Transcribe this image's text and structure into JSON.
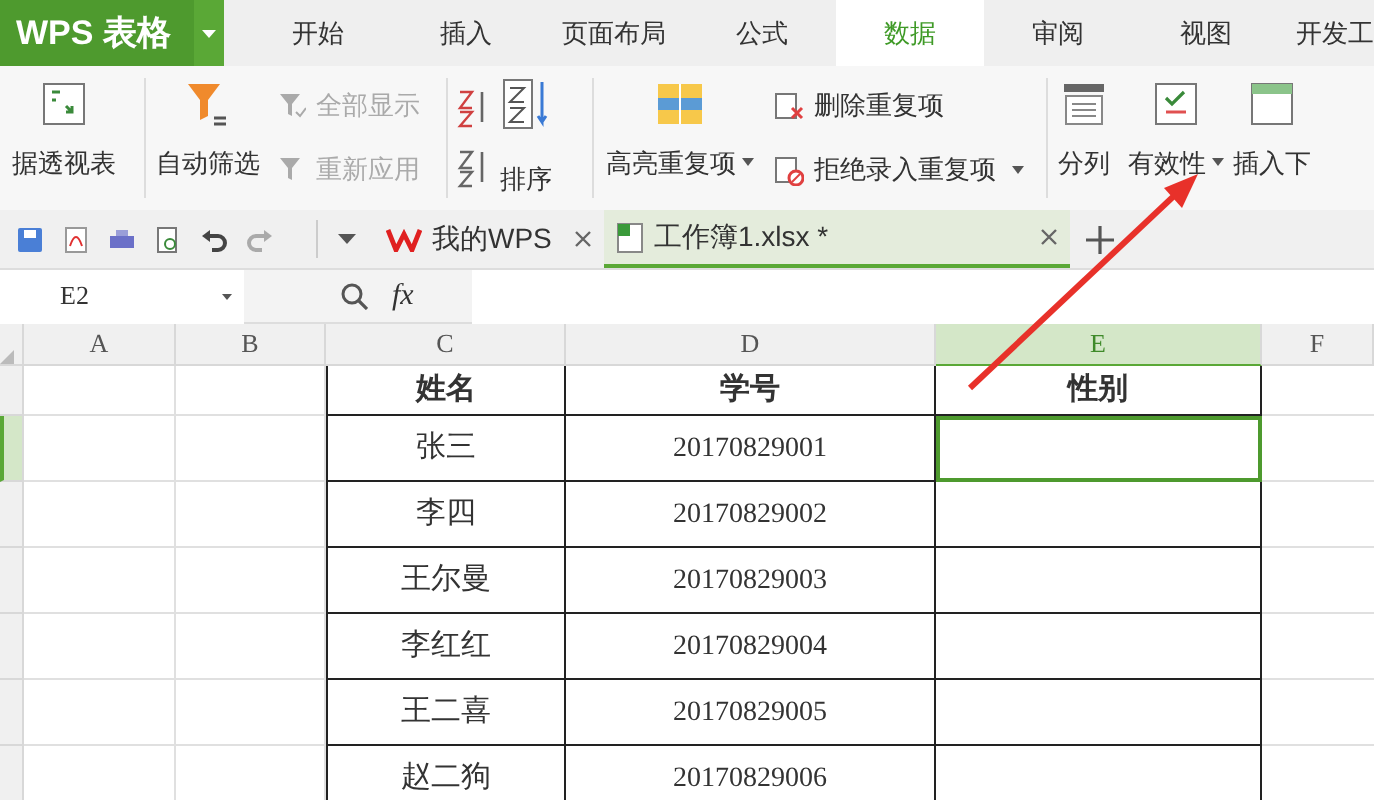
{
  "app_menu": {
    "title": "WPS 表格"
  },
  "menu_tabs": [
    {
      "label": "开始",
      "selected": false
    },
    {
      "label": "插入",
      "selected": false
    },
    {
      "label": "页面布局",
      "selected": false
    },
    {
      "label": "公式",
      "selected": false
    },
    {
      "label": "数据",
      "selected": true
    },
    {
      "label": "审阅",
      "selected": false
    },
    {
      "label": "视图",
      "selected": false
    },
    {
      "label": "开发工",
      "selected": false
    }
  ],
  "ribbon": [
    {
      "kind": "large",
      "label": "据透视表",
      "disabled": false,
      "dropdown": false
    },
    {
      "kind": "large",
      "label": "自动筛选",
      "disabled": false,
      "dropdown": false
    },
    {
      "kind": "stack",
      "items": [
        {
          "label": "全部显示",
          "disabled": true,
          "dropdown": false
        },
        {
          "label": "重新应用",
          "disabled": true,
          "dropdown": false
        }
      ]
    },
    {
      "kind": "sort",
      "label": "排序",
      "disabled": false,
      "dropdown": false
    },
    {
      "kind": "large",
      "label": "高亮重复项",
      "disabled": false,
      "dropdown": true
    },
    {
      "kind": "stack",
      "items": [
        {
          "label": "删除重复项",
          "disabled": false,
          "dropdown": false
        },
        {
          "label": "拒绝录入重复项",
          "disabled": false,
          "dropdown": true
        }
      ]
    },
    {
      "kind": "large",
      "label": "分列",
      "disabled": false,
      "dropdown": false
    },
    {
      "kind": "large",
      "label": "有效性",
      "disabled": false,
      "dropdown": true
    },
    {
      "kind": "large",
      "label": "插入下",
      "disabled": false,
      "dropdown": false
    }
  ],
  "doc_tabs": [
    {
      "label": "我的WPS",
      "selected": false
    },
    {
      "label": "工作簿1.xlsx *",
      "selected": true
    }
  ],
  "formula_bar": {
    "name_box": "E2",
    "fx": "fx"
  },
  "columns": [
    {
      "label": "A",
      "selected": false
    },
    {
      "label": "B",
      "selected": false
    },
    {
      "label": "C",
      "selected": false
    },
    {
      "label": "D",
      "selected": false
    },
    {
      "label": "E",
      "selected": true
    },
    {
      "label": "F",
      "selected": false
    }
  ],
  "table": {
    "header": [
      "姓名",
      "学号",
      "性别"
    ],
    "rows": [
      {
        "name": "张三",
        "student_id": "20170829001",
        "selected": true
      },
      {
        "name": "李四",
        "student_id": "20170829002",
        "selected": false
      },
      {
        "name": "王尔曼",
        "student_id": "20170829003",
        "selected": false
      },
      {
        "name": "李红红",
        "student_id": "20170829004",
        "selected": false
      },
      {
        "name": "王二喜",
        "student_id": "20170829005",
        "selected": false
      },
      {
        "name": "赵二狗",
        "student_id": "20170829006",
        "selected": false
      }
    ]
  }
}
